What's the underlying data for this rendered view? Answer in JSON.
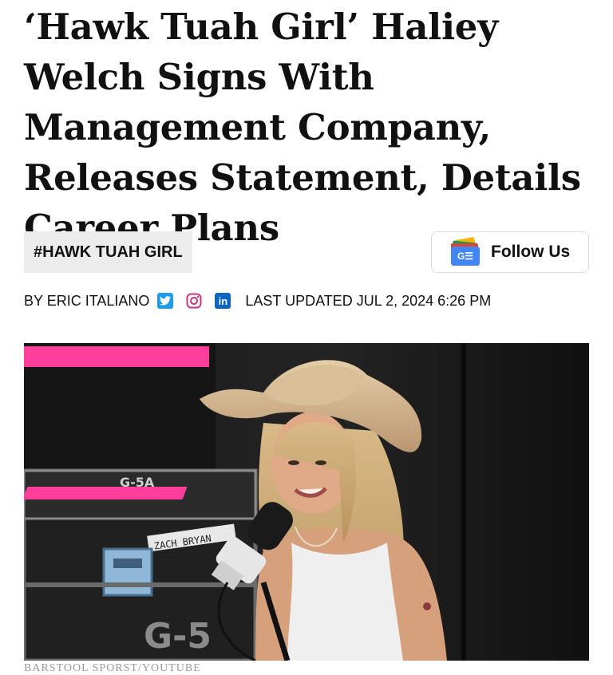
{
  "article": {
    "headline": "‘Hawk Tuah Girl’ Haliey Welch Signs With Management Company, Releases Statement, Details Career Plans",
    "tag": "#HAWK TUAH GIRL",
    "follow_label": "Follow Us",
    "follow_icon": "google-news-icon",
    "byline": {
      "author": "BY ERIC ITALIANO",
      "social_icons": [
        "twitter-icon",
        "instagram-icon",
        "linkedin-icon"
      ],
      "updated": "LAST UPDATED JUL 2, 2024 6:26 PM"
    },
    "image": {
      "credit": "BARSTOOL SPORST/YOUTUBE",
      "case_label": "ZACH BRYAN",
      "case_stencil": "G-5",
      "case_stencil_2": "G-5A"
    }
  },
  "colors": {
    "accent_pink": "#ff3d9a",
    "twitter": "#1d9bf0",
    "instagram": "#c13584",
    "linkedin": "#0a66c2"
  }
}
